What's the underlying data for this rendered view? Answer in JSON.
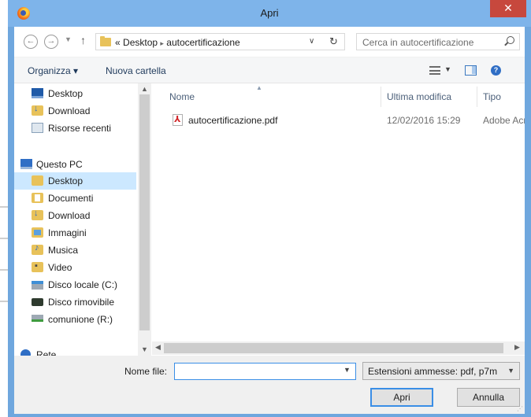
{
  "window": {
    "title": "Apri",
    "close_symbol": "✕"
  },
  "address": {
    "prefix": "«",
    "path": [
      "Desktop",
      "autocertificazione"
    ],
    "separator": "▸",
    "search_placeholder": "Cerca in autocertificazione"
  },
  "toolbar": {
    "organize": "Organizza ▾",
    "new_folder": "Nuova cartella"
  },
  "nav": {
    "quick": [
      {
        "label": "Desktop",
        "icon": "desktop-icon"
      },
      {
        "label": "Download",
        "icon": "download-folder-icon"
      },
      {
        "label": "Risorse recenti",
        "icon": "recent-places-icon"
      }
    ],
    "pc": {
      "label": "Questo PC",
      "icon": "computer-icon"
    },
    "pc_items": [
      {
        "label": "Desktop",
        "icon": "desktop-folder-icon",
        "selected": true
      },
      {
        "label": "Documenti",
        "icon": "documents-folder-icon"
      },
      {
        "label": "Download",
        "icon": "download-folder-icon"
      },
      {
        "label": "Immagini",
        "icon": "pictures-folder-icon"
      },
      {
        "label": "Musica",
        "icon": "music-folder-icon"
      },
      {
        "label": "Video",
        "icon": "video-folder-icon"
      },
      {
        "label": "Disco locale (C:)",
        "icon": "local-disk-icon"
      },
      {
        "label": "Disco rimovibile",
        "icon": "removable-disk-icon"
      },
      {
        "label": "comunione (R:)",
        "icon": "network-drive-icon"
      }
    ],
    "network": {
      "label": "Rete",
      "icon": "network-icon"
    }
  },
  "columns": {
    "name": "Nome",
    "modified": "Ultima modifica",
    "type": "Tipo"
  },
  "files": [
    {
      "name": "autocertificazione.pdf",
      "modified": "12/02/2016 15:29",
      "type": "Adobe Acrob",
      "icon": "pdf-icon"
    }
  ],
  "footer": {
    "filename_label": "Nome file:",
    "filename_value": "",
    "filetype": "Estensioni ammesse: pdf, p7m",
    "open": "Apri",
    "cancel": "Annulla"
  },
  "colors": {
    "titlebar": "#7eb4ea",
    "close": "#c7483d",
    "selection": "#cce8ff",
    "focus": "#3a8ee6"
  }
}
